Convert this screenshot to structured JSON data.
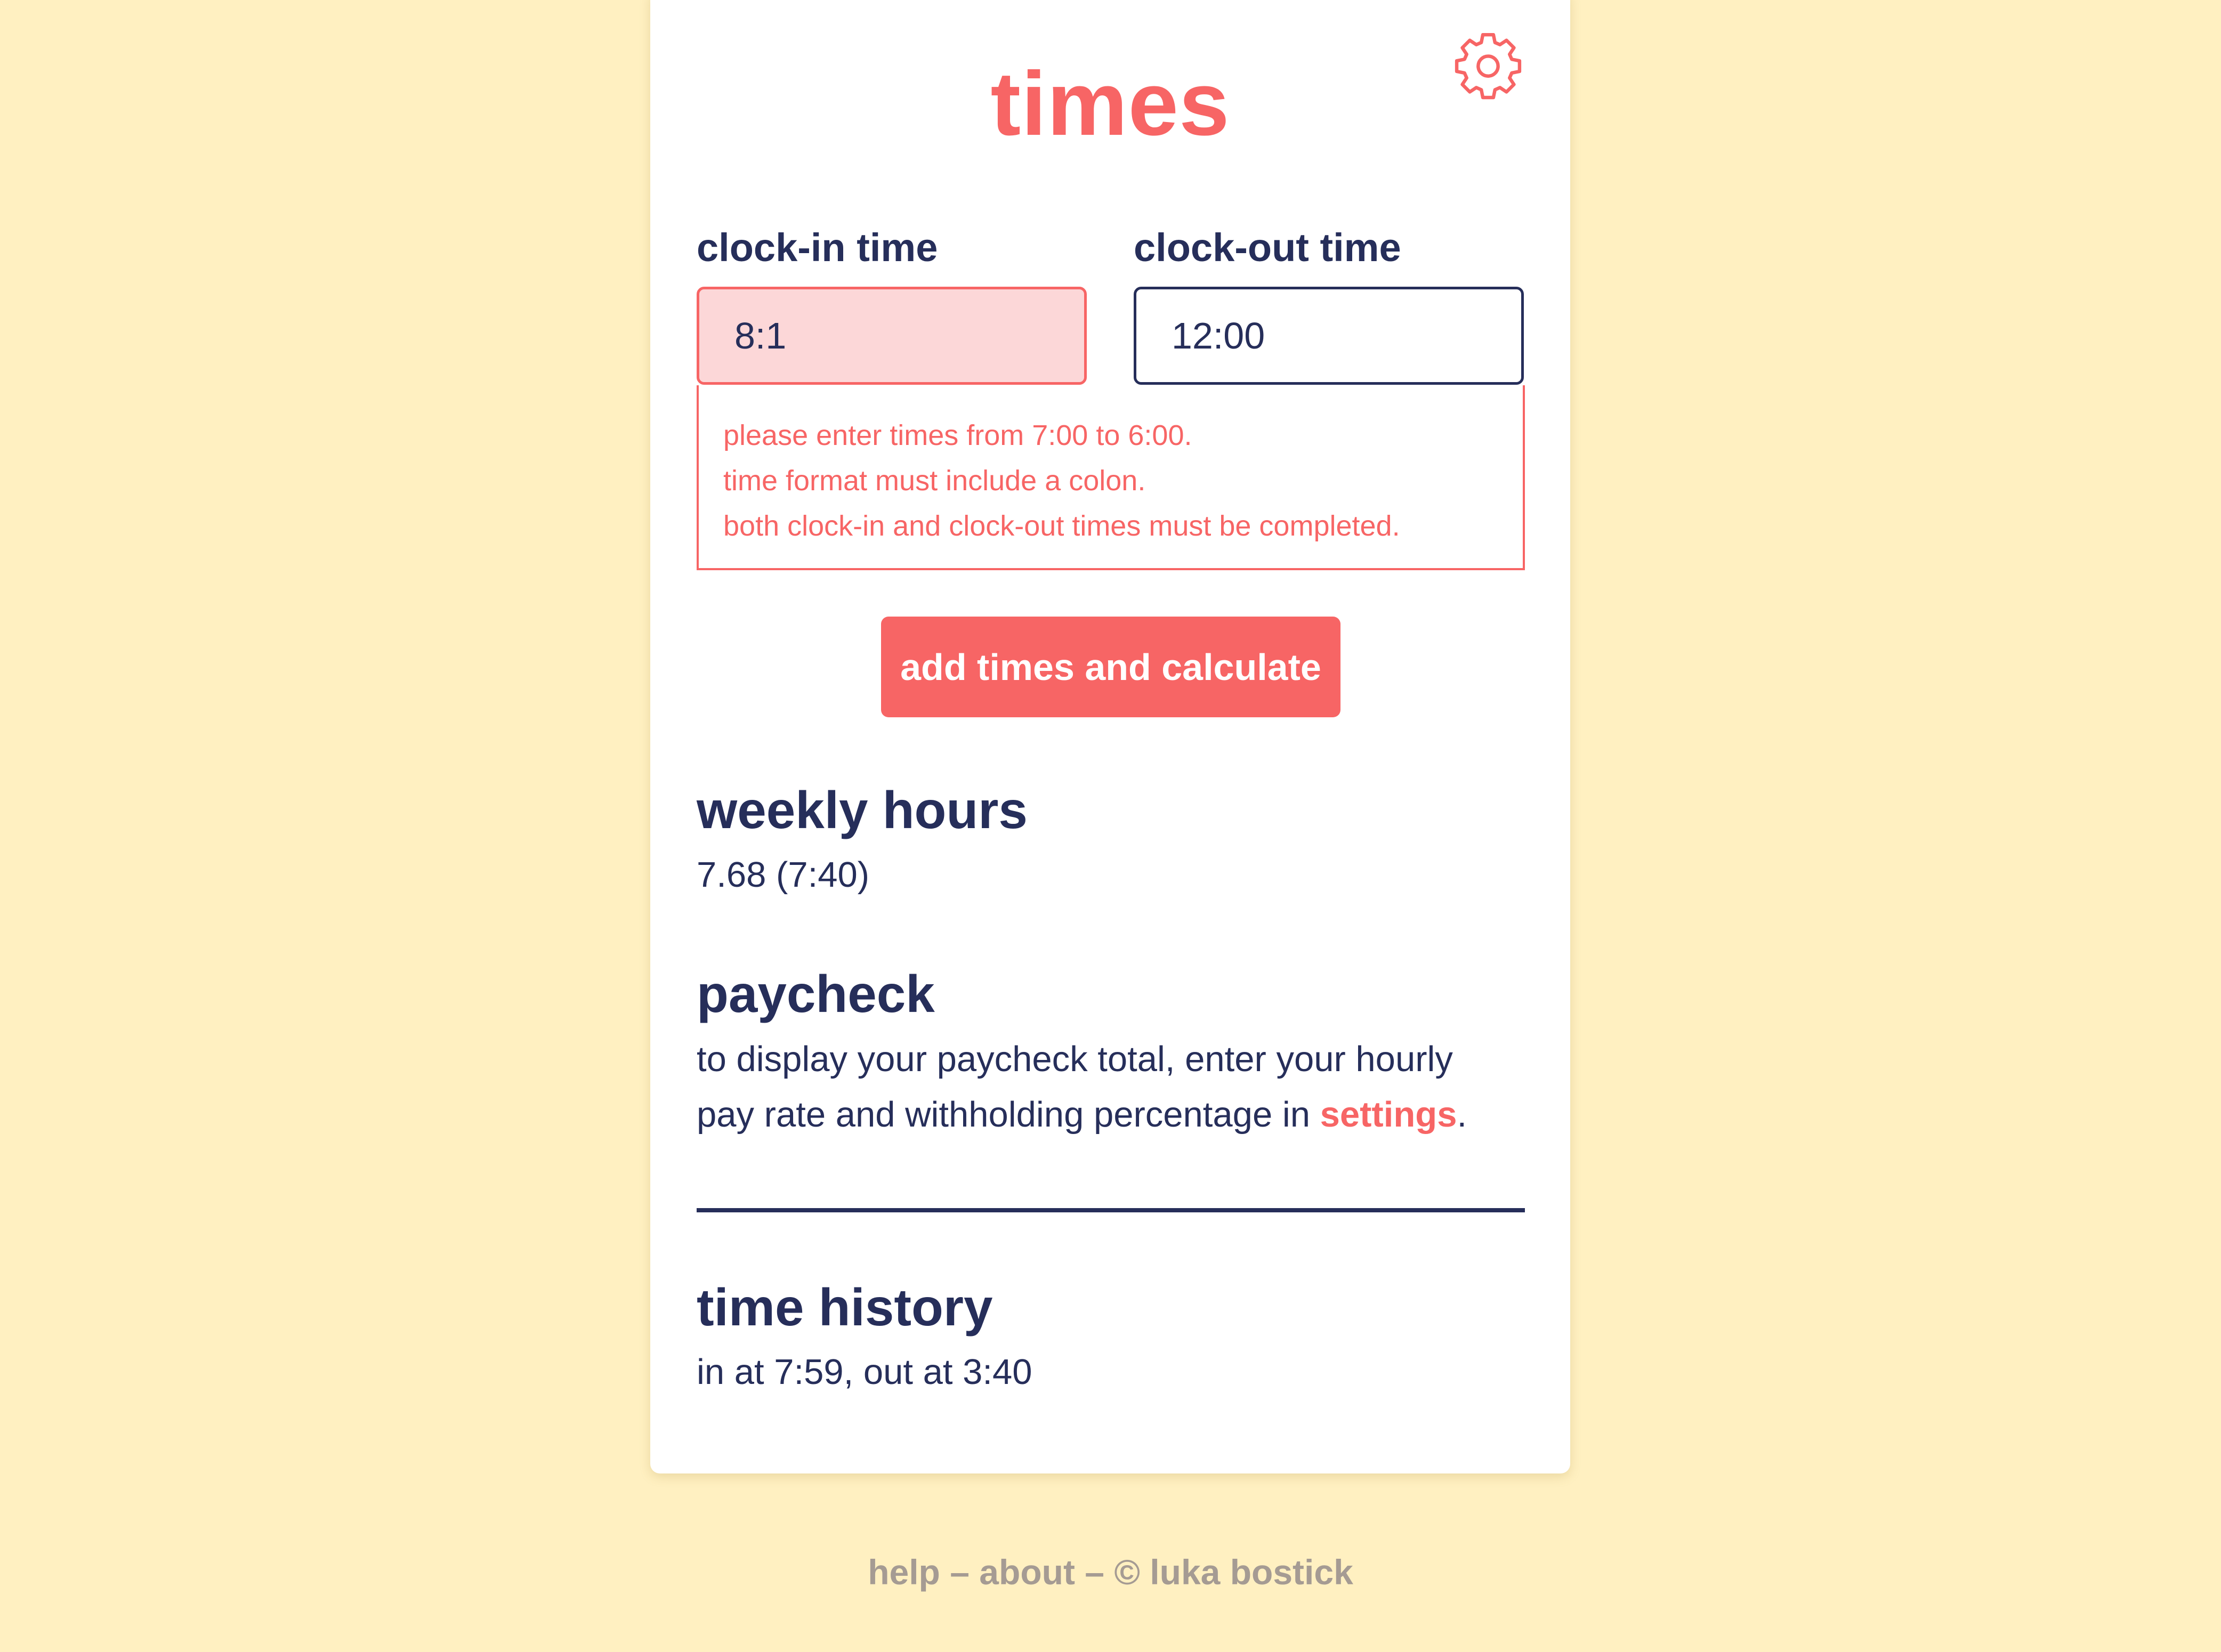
{
  "app": {
    "title": "times"
  },
  "settings_button": {
    "icon": "gear-icon"
  },
  "clock_in": {
    "label": "clock-in time",
    "value": "8:1",
    "state": "error"
  },
  "clock_out": {
    "label": "clock-out time",
    "value": "12:00"
  },
  "errors": [
    "please enter times from 7:00 to 6:00.",
    "time format must include a colon.",
    "both clock-in and clock-out times must be completed."
  ],
  "calculate_button": {
    "label": "add times and calculate"
  },
  "weekly_hours": {
    "heading": "weekly hours",
    "value": "7.68 (7:40)"
  },
  "paycheck": {
    "heading": "paycheck",
    "line1": "to display your paycheck total, enter your hourly",
    "line2_prefix": "pay rate and withholding percentage in ",
    "link": "settings",
    "line2_suffix": "."
  },
  "time_history": {
    "heading": "time history",
    "entries": [
      "in at 7:59, out at 3:40"
    ]
  },
  "footer": {
    "help": "help",
    "separator": "–",
    "about": "about",
    "copyright": "© luka bostick"
  },
  "colors": {
    "background": "#fff0c1",
    "accent": "#f76565",
    "text": "#262e5a",
    "error_fill": "#fcd7d8",
    "footer": "#a59b93"
  }
}
